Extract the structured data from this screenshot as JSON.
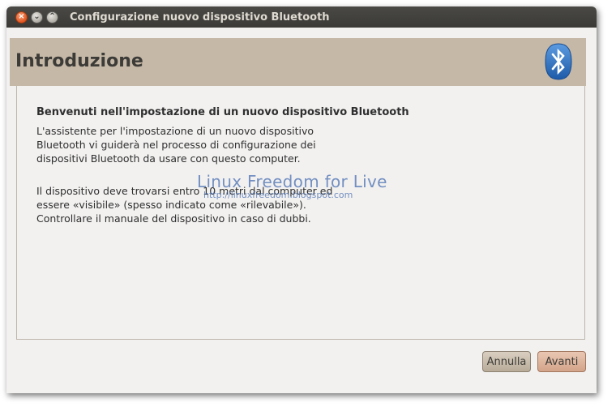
{
  "window": {
    "title": "Configurazione nuovo dispositivo Bluetooth",
    "controls": {
      "close": "×",
      "minimize": "⌄",
      "maximize": "⌃"
    }
  },
  "header": {
    "title": "Introduzione",
    "icon": "bluetooth-icon"
  },
  "content": {
    "heading": "Benvenuti nell'impostazione di un nuovo dispositivo Bluetooth",
    "paragraph1": "L'assistente per l'impostazione di un nuovo dispositivo Bluetooth vi guiderà nel processo di configurazione dei dispositivi Bluetooth da usare con questo computer.",
    "paragraph2": "Il dispositivo deve trovarsi entro 10 metri dal computer ed essere «visibile» (spesso indicato come «rilevabile»). Controllare il manuale del dispositivo in caso di dubbi."
  },
  "watermark": {
    "main": "Linux Freedom for Live",
    "sub": "http://linuxfreedom.blogspot.com"
  },
  "buttons": {
    "cancel": "Annulla",
    "forward": "Avanti"
  },
  "colors": {
    "header_bg": "#c5b8a7",
    "titlebar_bg": "#3b3a36",
    "bluetooth_blue": "#2a6fc4"
  }
}
